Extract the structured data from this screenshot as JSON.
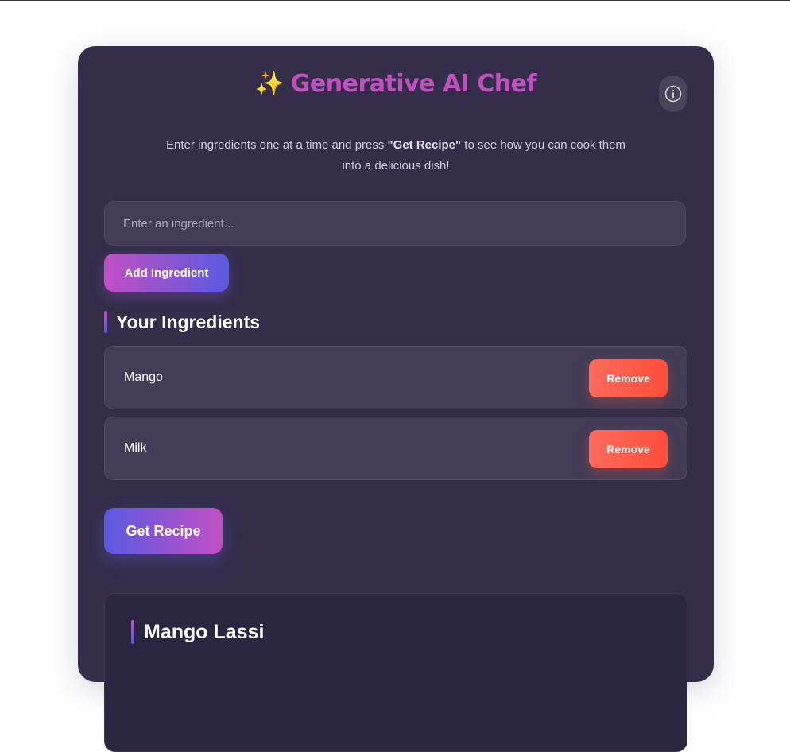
{
  "app": {
    "title": "Generative AI Chef",
    "title_icon": "sparkles-icon",
    "info_icon": "info-icon"
  },
  "intro": {
    "before": "Enter ingredients one at a time and press ",
    "highlight": "\"Get Recipe\"",
    "after": " to see how you can cook them into a delicious dish!"
  },
  "ingredient_input": {
    "placeholder": "Enter an ingredient...",
    "value": ""
  },
  "add_button_label": "Add Ingredient",
  "ingredients_section": {
    "heading": "Your Ingredients",
    "items": [
      {
        "name": "Mango",
        "remove_label": "Remove"
      },
      {
        "name": "Milk",
        "remove_label": "Remove"
      }
    ]
  },
  "get_recipe_label": "Get Recipe",
  "recipe": {
    "title": "Mango Lassi"
  },
  "colors": {
    "card_bg": "#342e4a",
    "accent_pink": "#c24fc4",
    "accent_blue": "#5a5ae0",
    "remove_red": "#ff5a48",
    "title_color": "#c04fc0"
  }
}
